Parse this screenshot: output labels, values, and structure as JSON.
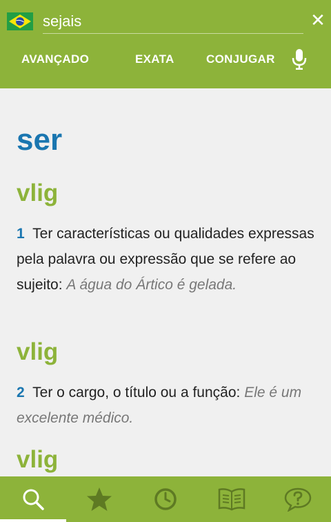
{
  "search": {
    "value": "sejais"
  },
  "modes": {
    "advanced": "AVANÇADO",
    "exact": "EXATA",
    "conjugate": "CONJUGAR"
  },
  "entry": {
    "headword": "ser",
    "senses": [
      {
        "pos": "vlig",
        "number": "1",
        "definition": "Ter características ou qualidades expressas pela palavra ou expressão que se refere ao sujeito:",
        "example": "A água do Ártico é gelada."
      },
      {
        "pos": "vlig",
        "number": "2",
        "definition": "Ter o cargo, o título ou a função:",
        "example": "Ele é um excelente médico."
      },
      {
        "pos": "vlig"
      }
    ]
  },
  "nav": [
    "search-icon",
    "star-icon",
    "clock-icon",
    "book-icon",
    "help-chat-icon"
  ],
  "colors": {
    "brand_green": "#8db33a",
    "headword_blue": "#1a76b0",
    "background": "#f0f0f0"
  }
}
